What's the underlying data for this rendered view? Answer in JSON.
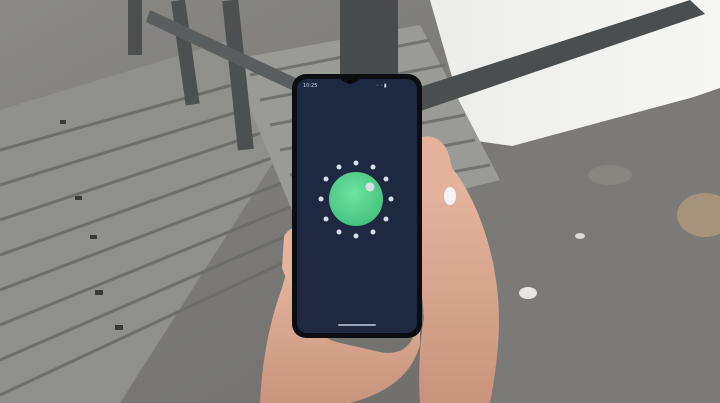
{
  "phone": {
    "status_time": "10:25",
    "status_icons": "◦◦▮",
    "screen_color": "#1e2840",
    "globe_color": "#55d68f",
    "dot_color": "#d9deeb"
  }
}
